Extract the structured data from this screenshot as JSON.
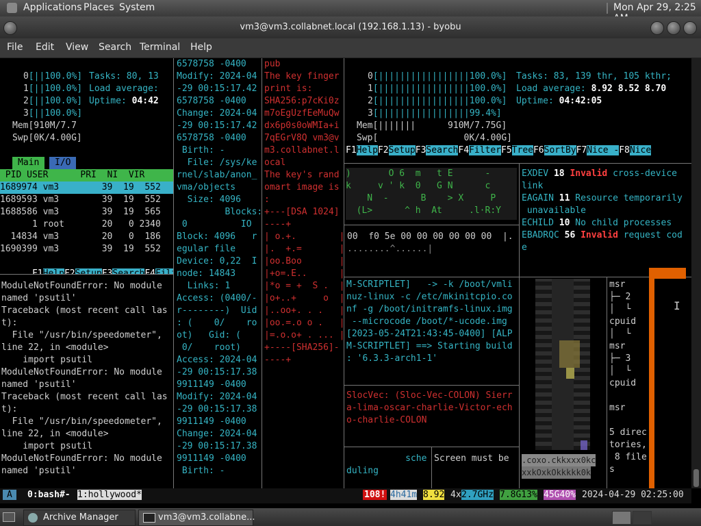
{
  "topbar": {
    "menus": [
      "Applications",
      "Places",
      "System"
    ],
    "clock": "Mon Apr 29,  2:25 AM"
  },
  "window": {
    "title": "vm3@vm3.collabnet.local (192.168.1.13) - byobu"
  },
  "menubar": [
    "File",
    "Edit",
    "View",
    "Search",
    "Terminal",
    "Help"
  ],
  "htop_left": {
    "cpus": [
      {
        "id": "0",
        "bar": "[||100.0%]"
      },
      {
        "id": "1",
        "bar": "[||100.0%]"
      },
      {
        "id": "2",
        "bar": "[||100.0%]"
      },
      {
        "id": "3",
        "bar": "[||100.0%]"
      }
    ],
    "tasks": "Tasks: 80, 13",
    "load": "Load average:",
    "uptime_label": "Uptime:",
    "uptime": "04:42",
    "mem": "Mem[910M/7.7",
    "swp": "Swp[0K/4.00G]",
    "tabs": [
      "Main",
      "I/O"
    ],
    "header": " PID USER      PRI  NI  VIR",
    "rows": [
      "1689974 vm3        39  19  552",
      "1689593 vm3        39  19  552",
      "1688586 vm3        39  19  565",
      "      1 root       20   0 2340",
      "  14834 vm3        20   0  186",
      "1690399 vm3        39  19  552"
    ],
    "fkeys": [
      [
        "F1",
        "Help"
      ],
      [
        "F2",
        "Setup"
      ],
      [
        "F3",
        "Search"
      ],
      [
        "F4",
        "Filte"
      ]
    ]
  },
  "pyerr": [
    "ModuleNotFoundError: No module",
    "named 'psutil'",
    "Traceback (most recent call las",
    "t):",
    "  File \"/usr/bin/speedometer\",",
    "line 22, in <module>",
    "    import psutil",
    "ModuleNotFoundError: No module",
    "named 'psutil'",
    "Traceback (most recent call las",
    "t):",
    "  File \"/usr/bin/speedometer\",",
    "line 22, in <module>",
    "    import psutil",
    "ModuleNotFoundError: No module",
    "named 'psutil'"
  ],
  "stat_pane": [
    "6578758 -0400",
    "Modify: 2024-04",
    "-29 00:15:17.42",
    "6578758 -0400",
    "Change: 2024-04",
    "-29 00:15:17.42",
    "6578758 -0400",
    " Birth: -",
    "  File: /sys/ke",
    "rnel/slab/anon_",
    "vma/objects",
    "  Size: 4096",
    "         Blocks:",
    " 0          IO",
    "Block: 4096   r",
    "egular file",
    "Device: 0,22  I",
    "node: 14843",
    "  Links: 1",
    "Access: (0400/-",
    "r--------)  Uid",
    ": (    0/    ro",
    "ot)   Gid: (",
    " 0/    root)",
    "Access: 2024-04",
    "-29 00:15:17.38",
    "9911149 -0400",
    "Modify: 2024-04",
    "-29 00:15:17.38",
    "9911149 -0400",
    "Change: 2024-04",
    "-29 00:15:17.38",
    "9911149 -0400",
    " Birth: -"
  ],
  "ssh_pane": [
    "pub",
    "The key finger",
    "print is:",
    "SHA256:p7cKi0z",
    "m7oEgUzfEeMuQw",
    "dx6p0s0oWMIa+i",
    "7qEGrV8Q vm3@v",
    "m3.collabnet.l",
    "ocal",
    "The key's rand",
    "omart image is",
    ":",
    "+---[DSA 1024]",
    "----+",
    "| o.+.        |",
    "|.  +.=       |",
    "|oo.Boo       |",
    "|+o=.E..      |",
    "|*o = +  S .  |",
    "|o+..+     o  |",
    "|..oo+. . .   |",
    "|oo.=.o o .   |",
    "|=.o.o+ . ... |",
    "+----[SHA256]-",
    "----+"
  ],
  "htop_right": {
    "cpus": [
      {
        "id": "0",
        "bar": "[|||||||||||||||||100.0%]"
      },
      {
        "id": "1",
        "bar": "[|||||||||||||||||100.0%]"
      },
      {
        "id": "2",
        "bar": "[|||||||||||||||||100.0%]"
      },
      {
        "id": "3",
        "bar": "[|||||||||||||||||99.4%]"
      }
    ],
    "tasks": "Tasks: 83, 139 thr, 105 kthr;",
    "load_label": "Load average:",
    "load": "8.92 8.52 8.70",
    "uptime_label": "Uptime:",
    "uptime": "04:42:05",
    "mem": "Mem[|||||||      910M/7.75G]",
    "swp": "Swp[                0K/4.00G]",
    "fkeys": [
      [
        "F1",
        "Help"
      ],
      [
        "F2",
        "Setup"
      ],
      [
        "F3",
        "Search"
      ],
      [
        "F4",
        "Filter"
      ],
      [
        "F5",
        "Tree"
      ],
      [
        "F6",
        "SortBy"
      ],
      [
        "F7",
        "Nice -"
      ],
      [
        "F8",
        "Nice"
      ]
    ]
  },
  "cmatrix": [
    ")       O 6  m   t E      -     '",
    "k     v ' k  0   G N      c     e",
    "    N  -      B    > X     P     E",
    "  (L>      ^ h  At     .l·R:Y   $ K"
  ],
  "hexline": [
    "00  f0 5e 00 00 00 00 00 00  |.",
    "........^......|"
  ],
  "errno": [
    [
      "EXDEV",
      "18",
      "Invalid",
      "cross-device"
    ],
    [
      "link"
    ],
    [
      "EAGAIN",
      "11",
      "Resource temporarily"
    ],
    [
      " unavailable"
    ],
    [
      "ECHILD",
      "10",
      "No child processes"
    ],
    [
      "EBADRQC",
      "56",
      "Invalid",
      "request cod"
    ],
    [
      "e"
    ]
  ],
  "mkinit": [
    "M-SCRIPTLET]   -> -k /boot/vmli",
    "nuz-linux -c /etc/mkinitcpio.co",
    "nf -g /boot/initramfs-linux.img",
    " --microcode /boot/*-ucode.img",
    "[2023-05-24T21:43:45-0400] [ALP",
    "M-SCRIPTLET] ==> Starting build",
    ": '6.3.3-arch1-1'"
  ],
  "nato": [
    "SlocVec: (Sloc-Vec-COLON) Sierr",
    "a-lima-oscar-charlie-Victor-ech",
    "o-charlie-COLON"
  ],
  "sched": [
    "           sche",
    "duling"
  ],
  "screen_msg": "Screen must be",
  "tree_pane": [
    "msr",
    "├─ 2",
    "│  └",
    "cpuid",
    "│  └",
    "msr",
    "├─ 3",
    "│  └",
    "cpuid",
    "",
    "msr",
    "",
    "5 direc",
    "tories,",
    " 8 file",
    "s"
  ],
  "asciiart_bottom": [
    ".coxo.ckkxxx0kc",
    "xxkOxkOkkkkk0k"
  ],
  "status": {
    "session": "A",
    "win1": "0:bash#-",
    "win2": "1:hollywood*",
    "updates": "108!",
    "uptime": "4h41m",
    "load": "8.92",
    "cpu_count": "4x",
    "freq": "2.7GHz",
    "mem": "7.8G13%",
    "disk": "45G40%",
    "datetime": "2024-04-29 02:25:00"
  },
  "taskbar": [
    {
      "label": "Archive Manager"
    },
    {
      "label": "vm3@vm3.collabne..."
    }
  ]
}
